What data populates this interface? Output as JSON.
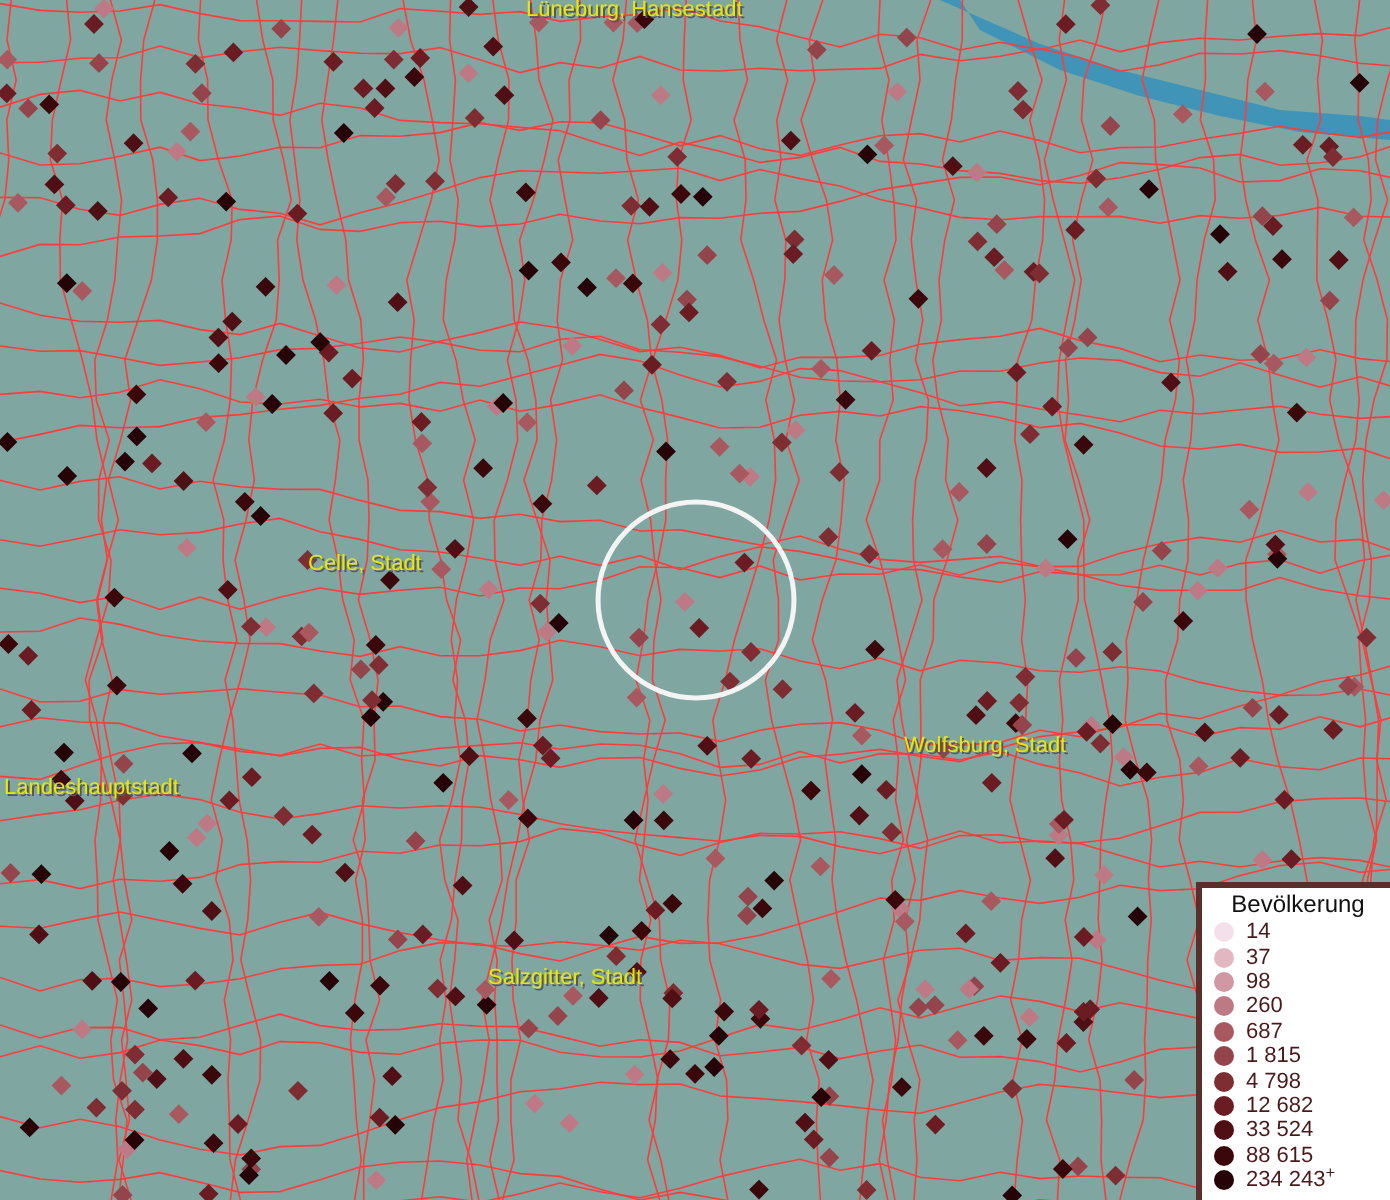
{
  "map": {
    "place_labels": [
      "Lüneburg, Hansestadt",
      "Celle, Stadt",
      "Landeshauptstadt",
      "Wolfsburg, Stadt",
      "Salzgitter, Stadt"
    ]
  },
  "legend": {
    "title": "Bevölkerung",
    "classes": [
      {
        "label": "14",
        "color": "#f3e0ea"
      },
      {
        "label": "37",
        "color": "#e2b7c2"
      },
      {
        "label": "98",
        "color": "#cf98a3"
      },
      {
        "label": "260",
        "color": "#bd7a85"
      },
      {
        "label": "687",
        "color": "#a8595f"
      },
      {
        "label": "1 815",
        "color": "#94454b"
      },
      {
        "label": "4 798",
        "color": "#7e2e33"
      },
      {
        "label": "12 682",
        "color": "#6b1c22"
      },
      {
        "label": "33 524",
        "color": "#4f0f14"
      },
      {
        "label": "88 615",
        "color": "#3a070a"
      },
      {
        "label": "234 243$^{+}$",
        "color": "#260306"
      }
    ]
  }
}
